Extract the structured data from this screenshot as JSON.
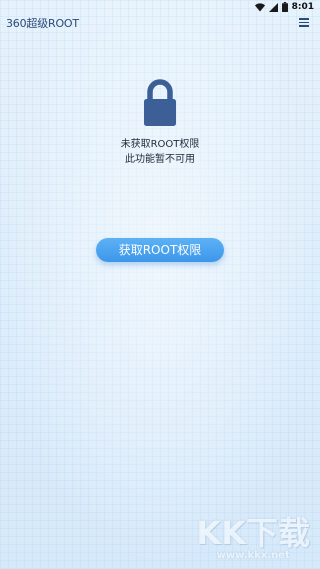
{
  "status_bar": {
    "time": "8:01",
    "icons": [
      "wifi-icon",
      "signal-icon",
      "battery-icon"
    ]
  },
  "app_bar": {
    "title": "360超级ROOT",
    "menu_icon": "menu-icon"
  },
  "main": {
    "lock_icon": "lock-icon",
    "lock_color": "#3b5f96",
    "message_line1": "未获取ROOT权限",
    "message_line2": "此功能暂不可用",
    "button_label": "获取ROOT权限",
    "button_color": "#4aa3ee"
  },
  "watermark": {
    "text": "KK下载",
    "url": "www.kkx.net"
  }
}
